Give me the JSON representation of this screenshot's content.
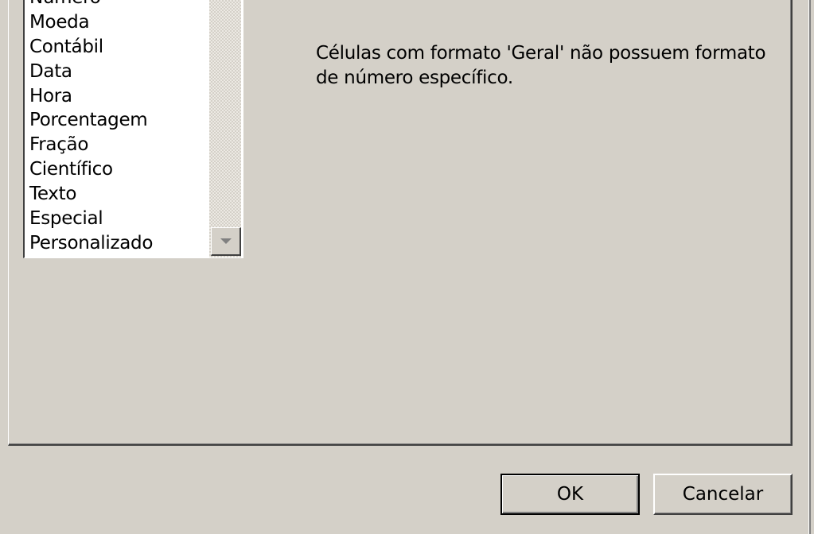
{
  "dialog": {
    "category_list": {
      "items": [
        {
          "label": "Número"
        },
        {
          "label": "Moeda"
        },
        {
          "label": "Contábil"
        },
        {
          "label": "Data"
        },
        {
          "label": "Hora"
        },
        {
          "label": "Porcentagem"
        },
        {
          "label": "Fração"
        },
        {
          "label": "Científico"
        },
        {
          "label": "Texto"
        },
        {
          "label": "Especial"
        },
        {
          "label": "Personalizado"
        }
      ]
    },
    "description": "Células com formato 'Geral' não possuem formato de número específico.",
    "buttons": {
      "ok_label": "OK",
      "cancel_label": "Cancelar"
    },
    "colors": {
      "face": "#d4d0c8",
      "list_background": "#ffffff",
      "shadow": "#404040"
    }
  }
}
